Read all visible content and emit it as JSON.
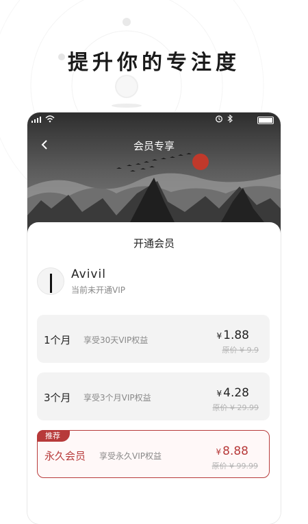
{
  "headline": "提升你的专注度",
  "status_bar": {
    "icons": [
      "signal-icon",
      "wifi-icon",
      "alarm-icon",
      "bluetooth-icon",
      "battery-icon"
    ]
  },
  "nav": {
    "title": "会员专享",
    "back_icon": "chevron-left-icon"
  },
  "sheet": {
    "title": "开通会员"
  },
  "user": {
    "name": "Avivil",
    "status": "当前未开通VIP"
  },
  "plans": [
    {
      "name": "1个月",
      "desc": "享受30天VIP权益",
      "currency": "¥",
      "price": "1.88",
      "original": "原价 ¥ 9.9",
      "recommended": false
    },
    {
      "name": "3个月",
      "desc": "享受3个月VIP权益",
      "currency": "¥",
      "price": "4.28",
      "original": "原价 ¥ 29.99",
      "recommended": false
    },
    {
      "name": "永久会员",
      "desc": "享受永久VIP权益",
      "currency": "¥",
      "price": "8.88",
      "original": "原价 ¥ 99.99",
      "recommended": true,
      "badge": "推荐"
    }
  ],
  "colors": {
    "accent": "#b73a3a",
    "hero_dark": "#3b3b3b",
    "sun": "#c0392b"
  }
}
